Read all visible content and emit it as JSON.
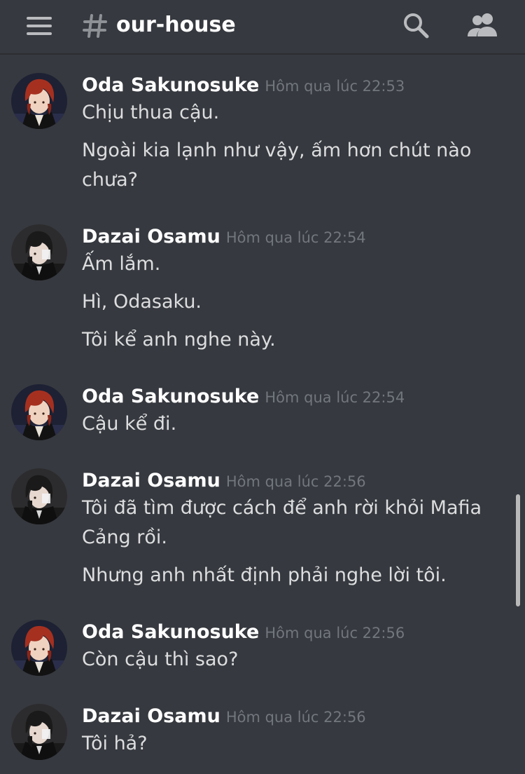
{
  "channel": {
    "name": "our-house"
  },
  "icons": {
    "menu": "hamburger-menu-icon",
    "hash": "hash-icon",
    "search": "search-icon",
    "members": "members-icon"
  },
  "colors": {
    "background": "#36393f",
    "author": "#ffffff",
    "timestamp": "#72767d",
    "message": "#dcddde"
  },
  "messages": [
    {
      "author": "Oda Sakunosuke",
      "timestamp": "Hôm qua lúc 22:53",
      "lines": [
        "Chịu thua cậu.",
        "Ngoài kia lạnh như vậy, ấm hơn chút nào chưa?"
      ]
    },
    {
      "author": "Dazai Osamu",
      "timestamp": "Hôm qua lúc 22:54",
      "lines": [
        "Ấm lắm.",
        "Hì, Odasaku.",
        "Tôi kể anh nghe này."
      ]
    },
    {
      "author": "Oda Sakunosuke",
      "timestamp": "Hôm qua lúc 22:54",
      "lines": [
        "Cậu kể đi."
      ]
    },
    {
      "author": "Dazai Osamu",
      "timestamp": "Hôm qua lúc 22:56",
      "lines": [
        "Tôi đã tìm được cách để anh rời khỏi Mafia Cảng rồi.",
        "Nhưng anh nhất định phải nghe lời tôi."
      ]
    },
    {
      "author": "Oda Sakunosuke",
      "timestamp": "Hôm qua lúc 22:56",
      "lines": [
        "Còn cậu thì sao?"
      ]
    },
    {
      "author": "Dazai Osamu",
      "timestamp": "Hôm qua lúc 22:56",
      "lines": [
        "Tôi hả?"
      ]
    }
  ]
}
